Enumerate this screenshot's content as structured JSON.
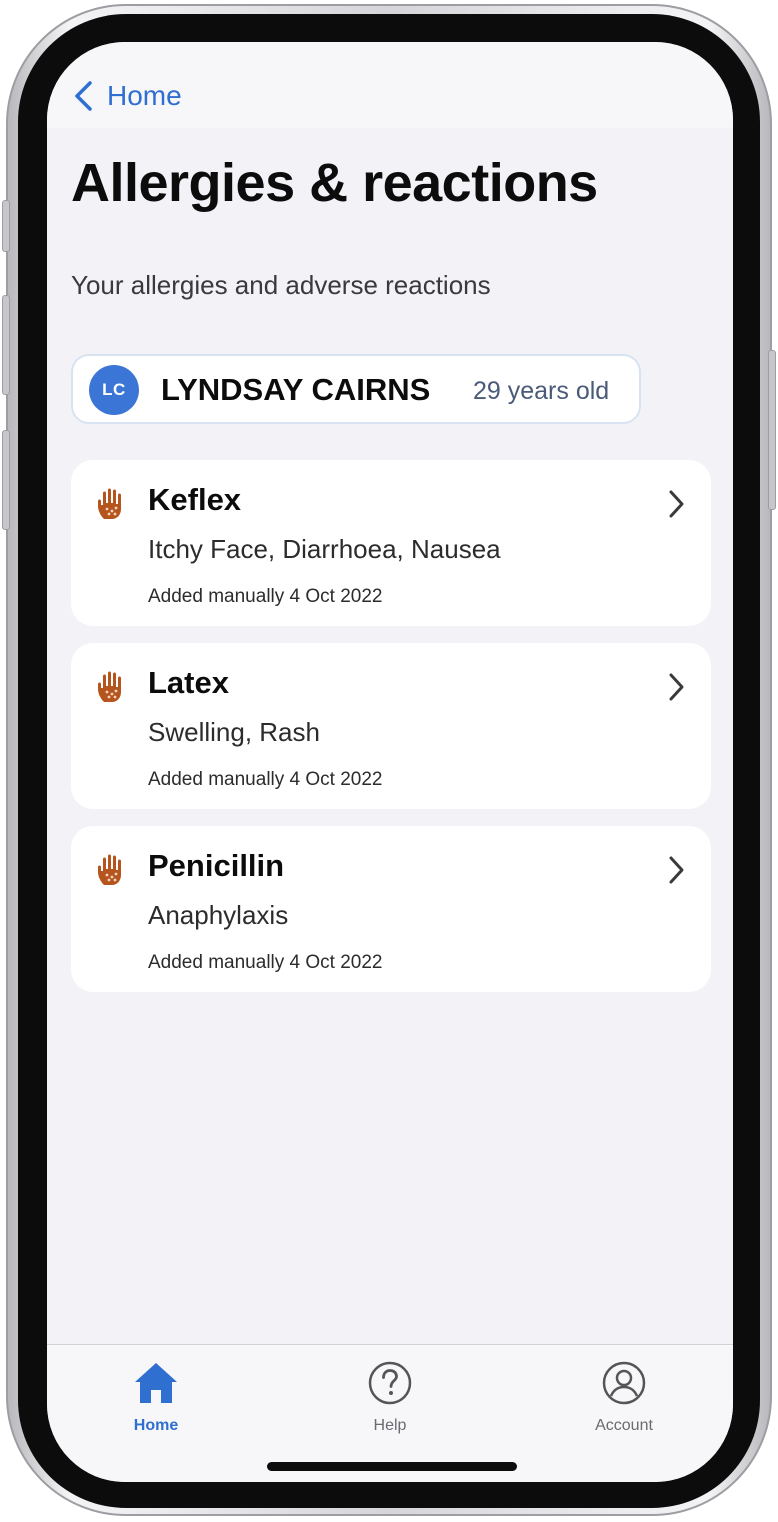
{
  "nav": {
    "back_label": "Home"
  },
  "page": {
    "title": "Allergies & reactions",
    "subtitle": "Your allergies and adverse reactions"
  },
  "patient": {
    "initials": "LC",
    "name": "LYNDSAY CAIRNS",
    "age": "29 years old"
  },
  "allergies": [
    {
      "name": "Keflex",
      "reactions": "Itchy Face, Diarrhoea, Nausea",
      "added": "Added manually 4 Oct 2022"
    },
    {
      "name": "Latex",
      "reactions": "Swelling, Rash",
      "added": "Added manually 4 Oct 2022"
    },
    {
      "name": "Penicillin",
      "reactions": "Anaphylaxis",
      "added": "Added manually 4 Oct 2022"
    }
  ],
  "tabs": [
    {
      "label": "Home",
      "icon": "house-icon",
      "active": true
    },
    {
      "label": "Help",
      "icon": "question-circle-icon",
      "active": false
    },
    {
      "label": "Account",
      "icon": "person-circle-icon",
      "active": false
    }
  ],
  "colors": {
    "accent": "#2f6fd0",
    "avatar": "#3b76d6",
    "allergy_icon": "#b5541c",
    "background": "#f2f2f7"
  }
}
